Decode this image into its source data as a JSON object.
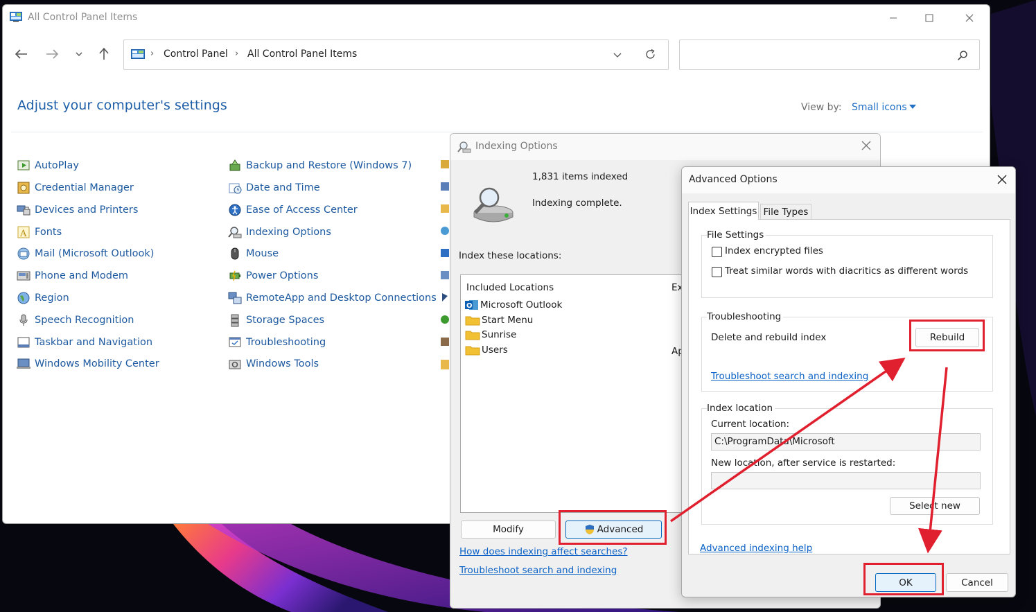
{
  "colors": {
    "link": "#1e5aa0",
    "heading": "#1f5fa8",
    "accent": "#0067c0",
    "annotation": "#e0202e"
  },
  "control_panel": {
    "window_title": "All Control Panel Items",
    "breadcrumb": [
      "Control Panel",
      "All Control Panel Items"
    ],
    "search_placeholder": "",
    "heading": "Adjust your computer's settings",
    "view_by_label": "View by:",
    "view_by_value": "Small icons",
    "column1": [
      {
        "label": "AutoPlay",
        "icon": "autoplay-icon"
      },
      {
        "label": "Credential Manager",
        "icon": "credential-manager-icon"
      },
      {
        "label": "Devices and Printers",
        "icon": "devices-printers-icon"
      },
      {
        "label": "Fonts",
        "icon": "fonts-icon"
      },
      {
        "label": "Mail (Microsoft Outlook)",
        "icon": "mail-icon"
      },
      {
        "label": "Phone and Modem",
        "icon": "phone-modem-icon"
      },
      {
        "label": "Region",
        "icon": "region-icon"
      },
      {
        "label": "Speech Recognition",
        "icon": "speech-recognition-icon"
      },
      {
        "label": "Taskbar and Navigation",
        "icon": "taskbar-icon"
      },
      {
        "label": "Windows Mobility Center",
        "icon": "mobility-center-icon"
      }
    ],
    "column2": [
      {
        "label": "Backup and Restore (Windows 7)",
        "icon": "backup-restore-icon"
      },
      {
        "label": "Date and Time",
        "icon": "date-time-icon"
      },
      {
        "label": "Ease of Access Center",
        "icon": "ease-of-access-icon"
      },
      {
        "label": "Indexing Options",
        "icon": "indexing-options-icon"
      },
      {
        "label": "Mouse",
        "icon": "mouse-icon"
      },
      {
        "label": "Power Options",
        "icon": "power-options-icon"
      },
      {
        "label": "RemoteApp and Desktop Connections",
        "icon": "remoteapp-icon"
      },
      {
        "label": "Storage Spaces",
        "icon": "storage-spaces-icon"
      },
      {
        "label": "Troubleshooting",
        "icon": "troubleshooting-icon"
      },
      {
        "label": "Windows Tools",
        "icon": "windows-tools-icon"
      }
    ]
  },
  "indexing_dialog": {
    "title": "Indexing Options",
    "items_indexed": "1,831 items indexed",
    "status": "Indexing complete.",
    "locations_label": "Index these locations:",
    "list_header": "Included Locations",
    "locations": [
      "Microsoft Outlook",
      "Start Menu",
      "Sunrise",
      "Users"
    ],
    "exclude_header_fragment": "Ex",
    "exclude_value_fragment": "Ap",
    "modify_label": "Modify",
    "advanced_label": "Advanced",
    "link_how": "How does indexing affect searches?",
    "link_troubleshoot": "Troubleshoot search and indexing"
  },
  "advanced_dialog": {
    "title": "Advanced Options",
    "tabs": [
      "Index Settings",
      "File Types"
    ],
    "file_settings_title": "File Settings",
    "checkbox_encrypted": "Index encrypted files",
    "checkbox_diacritics": "Treat similar words with diacritics as different words",
    "troubleshooting_title": "Troubleshooting",
    "rebuild_text": "Delete and rebuild index",
    "rebuild_label": "Rebuild",
    "troubleshoot_link": "Troubleshoot search and indexing",
    "index_location_title": "Index location",
    "current_location_label": "Current location:",
    "current_location_value": "C:\\ProgramData\\Microsoft",
    "new_location_label": "New location, after service is restarted:",
    "new_location_value": "",
    "select_new_label": "Select new",
    "help_link": "Advanced indexing help",
    "ok_label": "OK",
    "cancel_label": "Cancel"
  }
}
